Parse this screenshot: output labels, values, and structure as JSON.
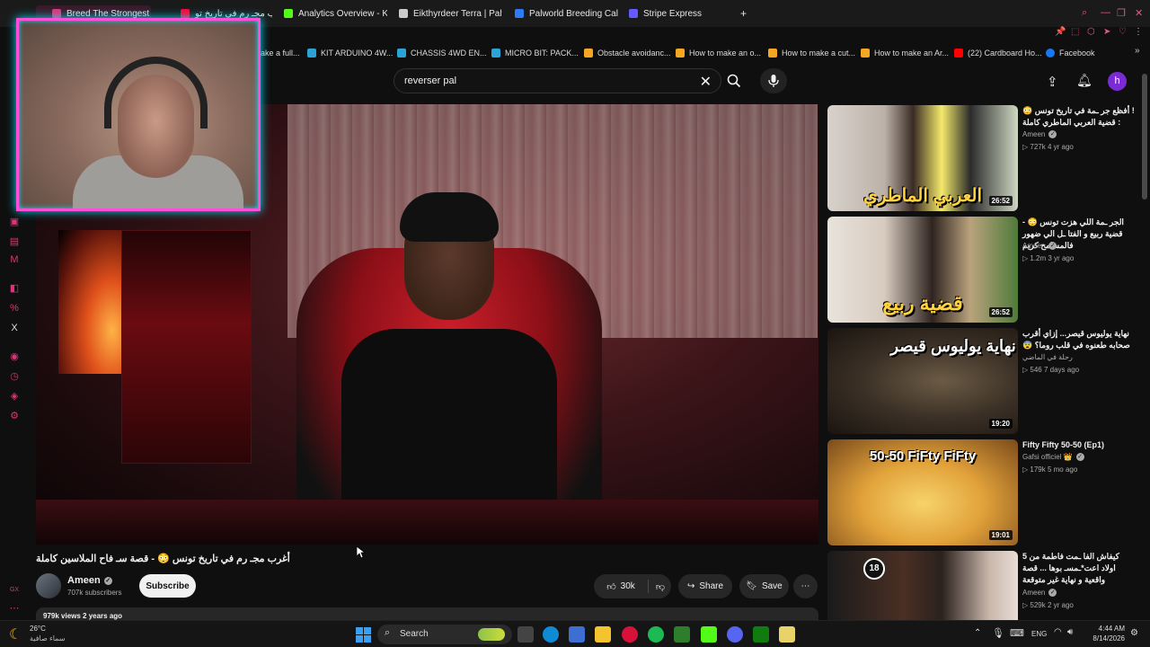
{
  "browser": {
    "tabs": [
      {
        "label": "Breed The Strongest Palw",
        "icon": "youtube-favicon",
        "color": "#e0327a"
      },
      {
        "label": "أغرب مجـ رم في تاريخ تو",
        "icon": "audio-icon",
        "color": "#ff0033"
      },
      {
        "label": "Analytics Overview - Kick",
        "icon": "kick-favicon",
        "color": "#53fc18"
      },
      {
        "label": "Eikthyrdeer Terra | Palworld",
        "icon": "palworld-favicon",
        "color": "#cccccc"
      },
      {
        "label": "Palworld Breeding Calculator",
        "icon": "p-favicon",
        "color": "#2d7cf6"
      },
      {
        "label": "Stripe Express",
        "icon": "stripe-favicon",
        "color": "#635bff"
      }
    ],
    "new_tab": "+",
    "bookmarks": [
      {
        "label": "ake a full..."
      },
      {
        "label": "KIT ARDUINO 4W..."
      },
      {
        "label": "CHASSIS 4WD EN..."
      },
      {
        "label": "MICRO BIT: PACK..."
      },
      {
        "label": "Obstacle avoidanc..."
      },
      {
        "label": "How to make an o..."
      },
      {
        "label": "How to make a cut..."
      },
      {
        "label": "How to make an Ar..."
      },
      {
        "label": "(22) Cardboard Ho..."
      },
      {
        "label": "Facebook"
      }
    ]
  },
  "youtube": {
    "search": {
      "value": "reverser pal",
      "clear": "✕"
    },
    "user_initial": "h",
    "video": {
      "title": "أغرب مجـ رم في تاريخ تونس 😳 - قصة سـ فاح الملاسين كاملة",
      "channel": "Ameen",
      "subscribers": "707k subscribers",
      "subscribe_label": "Subscribe",
      "likes": "30k",
      "share_label": "Share",
      "save_label": "Save",
      "more_label": "⋯",
      "views_partial": "979k views  2 years ago"
    },
    "recommendations": [
      {
        "title": "! أفظع جر ـمة في تاريخ تونس 😳 : قضية العربي الماطري كاملة",
        "channel": "Ameen",
        "meta": "▷ 727k  4 yr ago",
        "duration": "26:52",
        "thumb_text": "العربي الماطري"
      },
      {
        "title": "الجر ـمة اللي هزت تونس 😳 - قضية ربيع و الفتا ـل الي ضهور فالمسامح كريم",
        "channel": "Ameen",
        "meta": "▷ 1.2m  3 yr ago",
        "duration": "26:52",
        "thumb_text": "قضية ربيع"
      },
      {
        "title": "نهاية يوليوس قيصر... إزاي أقرب صحابه طعنوه في قلب روما؟ 😨",
        "channel": "رحلة في الماضي",
        "meta": "▷ 546  7 days ago",
        "duration": "19:20",
        "thumb_text": "نهاية يوليوس قيصر"
      },
      {
        "title": "Fifty Fifty 50-50 (Ep1)",
        "channel": "Gafsi officiel 👑",
        "meta": "▷ 179k  5 mo ago",
        "duration": "19:01",
        "thumb_text": "50-50 FiFty FiFty"
      },
      {
        "title": "كيفاش الفا ـمت فاطمة من 5 اولاد اعت*ـمسـ بوها ... قصة واقعية و نهاية غير متوقعة",
        "channel": "Ameen",
        "meta": "▷ 529k  2 yr ago",
        "duration": "",
        "thumb_text": ""
      }
    ]
  },
  "taskbar": {
    "weather_temp": "26°C",
    "weather_desc": "سماء صافية",
    "search_label": "Search",
    "lang": "ENG",
    "time": "4:44 AM",
    "date": "8/14/2026"
  }
}
